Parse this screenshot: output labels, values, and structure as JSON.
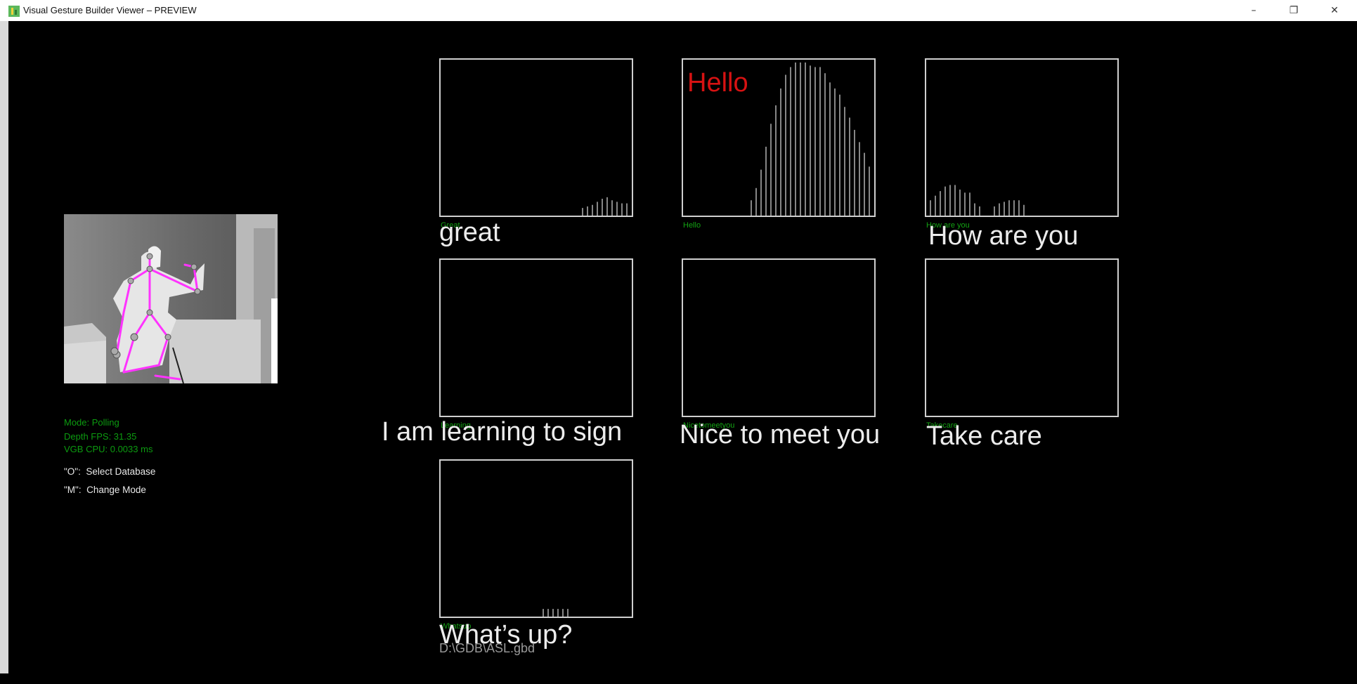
{
  "window": {
    "title": "Visual Gesture Builder Viewer – PREVIEW",
    "minimize_glyph": "–",
    "restore_glyph": "❐",
    "close_glyph": "✕"
  },
  "status": {
    "mode": "Mode: Polling",
    "depth_fps": "Depth FPS: 31.35",
    "vgb_cpu": "VGB CPU: 0.0033 ms"
  },
  "help": {
    "select_db": "\"O\":  Select Database",
    "change_mode": "\"M\":  Change Mode"
  },
  "colors": {
    "accent_green": "#0c9b10",
    "detected_red": "#d61212",
    "skeleton": "#ff33ff"
  },
  "panels": [
    {
      "gesture": "Great",
      "caption": "great",
      "detected": "",
      "bars": [
        0,
        0,
        0,
        0,
        0,
        0,
        0,
        0,
        0,
        0,
        0,
        0,
        0,
        0,
        0,
        0,
        0,
        0,
        0,
        0,
        0,
        0,
        0,
        0,
        0,
        0,
        0,
        0,
        0.05,
        0.06,
        0.07,
        0.09,
        0.11,
        0.12,
        0.1,
        0.09,
        0.08,
        0.08,
        0.06
      ]
    },
    {
      "gesture": "Hello",
      "caption": "",
      "detected": "Hello",
      "bars": [
        0,
        0,
        0,
        0,
        0,
        0,
        0,
        0,
        0,
        0,
        0,
        0,
        0,
        0.1,
        0.18,
        0.3,
        0.45,
        0.6,
        0.72,
        0.83,
        0.92,
        0.97,
        1.0,
        1.0,
        1.0,
        0.98,
        0.97,
        0.97,
        0.93,
        0.87,
        0.83,
        0.79,
        0.71,
        0.64,
        0.56,
        0.48,
        0.41,
        0.32,
        0.24,
        0.17
      ]
    },
    {
      "gesture": "How are you",
      "caption": "How are you",
      "detected": "",
      "bars": [
        0.1,
        0.13,
        0.16,
        0.19,
        0.2,
        0.2,
        0.17,
        0.15,
        0.15,
        0.08,
        0.06,
        0,
        0,
        0.06,
        0.08,
        0.09,
        0.1,
        0.1,
        0.1,
        0.07
      ]
    },
    {
      "gesture": "Learning",
      "caption": "I am learning to sign",
      "detected": "",
      "bars": []
    },
    {
      "gesture": "Nicetomeetyou",
      "caption": "Nice to meet you",
      "detected": "",
      "bars": []
    },
    {
      "gesture": "Takecare",
      "caption": "Take care",
      "detected": "",
      "bars": []
    },
    {
      "gesture": "Whatsup",
      "caption": "What’s up?",
      "detected": "",
      "bars": [
        0,
        0,
        0,
        0,
        0,
        0,
        0,
        0,
        0,
        0,
        0,
        0,
        0,
        0,
        0,
        0,
        0,
        0,
        0,
        0,
        0.05,
        0.05,
        0.05,
        0.05,
        0.05,
        0.05
      ]
    }
  ],
  "database_path": "D:\\GDB\\ASL.gbd"
}
